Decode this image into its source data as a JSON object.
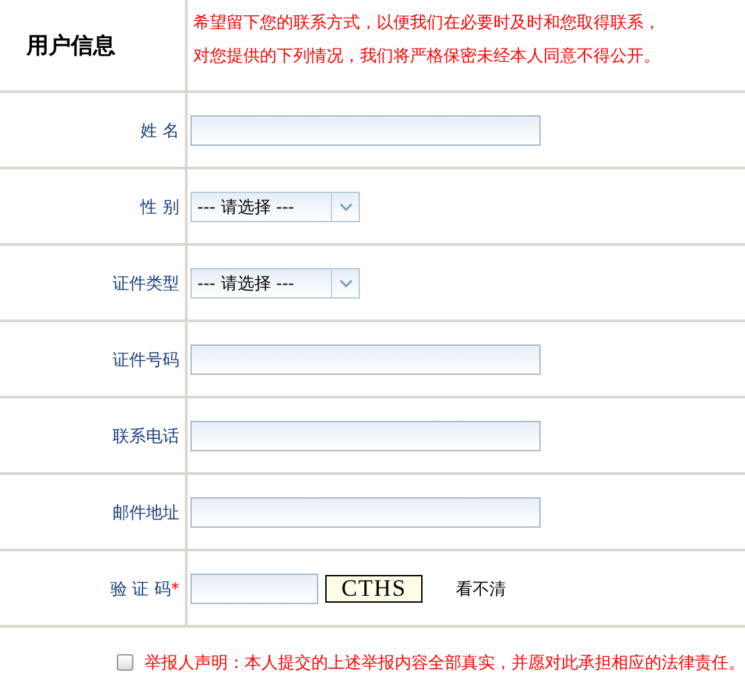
{
  "header": {
    "title": "用户信息",
    "notice": [
      "希望留下您的联系方式，以便我们在必要时及时和您取得联系，",
      "对您提供的下列情况，我们将严格保密未经本人同意不得公开。"
    ]
  },
  "fields": [
    {
      "kind": "text",
      "label": "姓 名"
    },
    {
      "kind": "select",
      "label": "性 别",
      "value": "--- 请选择 ---"
    },
    {
      "kind": "select",
      "label": "证件类型",
      "value": "--- 请选择 ---"
    },
    {
      "kind": "text",
      "label": "证件号码"
    },
    {
      "kind": "text",
      "label": "联系电话"
    },
    {
      "kind": "text",
      "label": "邮件地址"
    },
    {
      "kind": "captcha",
      "label": "验 证 码",
      "required_mark": "*",
      "captcha": "CTHS",
      "refresh": "看不清"
    }
  ],
  "declaration": {
    "checked": false,
    "text": "举报人声明：本人提交的上述举报内容全部真实，并愿对此承担相应的法律责任。"
  }
}
